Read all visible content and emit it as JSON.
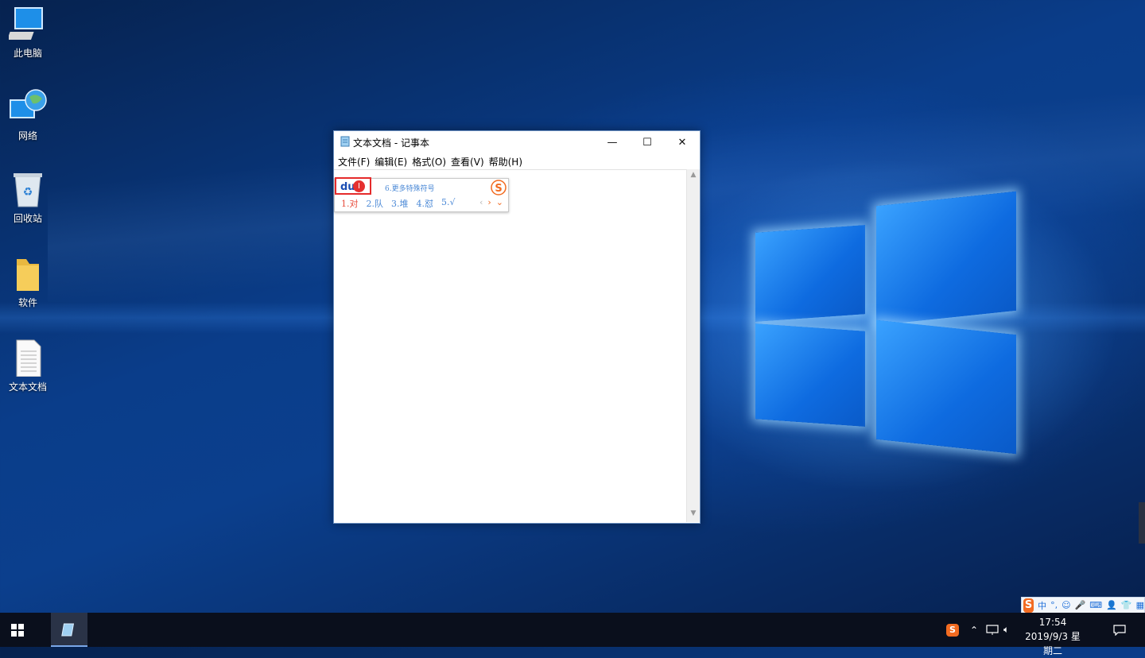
{
  "desktop": {
    "icons": [
      {
        "label": "此电脑",
        "icon": "computer-icon"
      },
      {
        "label": "网络",
        "icon": "network-icon"
      },
      {
        "label": "回收站",
        "icon": "recycle-bin-icon"
      },
      {
        "label": "软件",
        "icon": "folder-icon"
      },
      {
        "label": "文本文档",
        "icon": "text-document-icon"
      }
    ]
  },
  "notepad": {
    "title": "文本文档 - 记事本",
    "menu": [
      "文件(F)",
      "编辑(E)",
      "格式(O)",
      "查看(V)",
      "帮助(H)"
    ],
    "controls": {
      "minimize": "—",
      "maximize": "☐",
      "close": "✕"
    }
  },
  "ime_candidates": {
    "composition": "dui",
    "hint": "6.更多特殊符号",
    "candidates": [
      "1.对",
      "2.队",
      "3.堆",
      "4.怼",
      "5.√"
    ],
    "prev": "‹",
    "next": "›",
    "expand": "⌄",
    "logo": "S"
  },
  "taskbar": {
    "time": "17:54",
    "date": "2019/9/3 星期二",
    "ime_toolbar": [
      "中",
      "°,",
      "☺",
      "🎤",
      "⌨",
      "👤",
      "👕",
      "▦"
    ],
    "colors": {
      "accent": "#f26b21",
      "taskbar": "#0a0f1c"
    }
  }
}
